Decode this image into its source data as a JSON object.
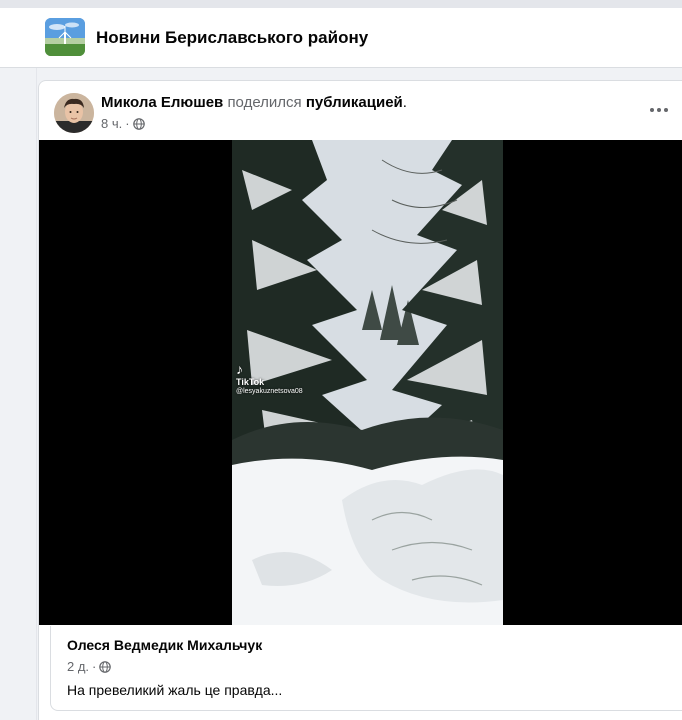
{
  "group": {
    "name": "Новини Бериславського району",
    "avatar_icon": "group-cover-photo"
  },
  "post": {
    "author": "Микола Елюшев",
    "shared_verb": "поделился",
    "shared_object": "публикацией",
    "period": ".",
    "time": "8 ч.",
    "separator": "·",
    "privacy_icon": "globe-icon",
    "more_icon": "more-options-icon"
  },
  "video": {
    "watermark_brand": "TikTok",
    "watermark_handle": "@lesyakuznetsova08"
  },
  "shared_post": {
    "author": "Олеся Ведмедик Михальчук",
    "time": "2 д.",
    "separator": "·",
    "privacy_icon": "globe-icon",
    "text": "На превеликий жаль це правда..."
  },
  "colors": {
    "text_primary": "#050505",
    "text_secondary": "#65676b",
    "background": "#f0f2f5",
    "card": "#ffffff"
  }
}
